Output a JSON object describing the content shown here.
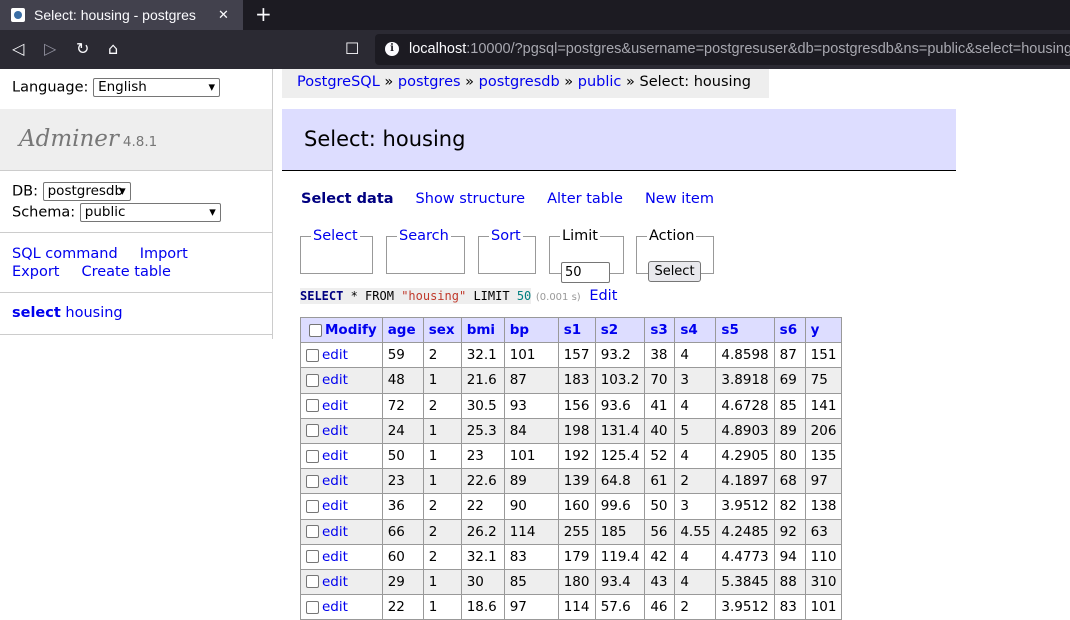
{
  "browser": {
    "tab_title": "Select: housing - postgres",
    "tab_close": "✕",
    "new_tab": "+",
    "url_host": "localhost",
    "url_rest": ":10000/?pgsql=postgres&username=postgresuser&db=postgresdb&ns=public&select=housing",
    "back": "◁",
    "forward": "▷",
    "reload": "↻",
    "home": "⌂",
    "bookmark": "☐"
  },
  "menu": {
    "language_label": "Language:",
    "language_value": "English",
    "logo": "Adminer",
    "version": "4.8.1",
    "db_label": "DB:",
    "db_value": "postgresdb",
    "schema_label": "Schema:",
    "schema_value": "public",
    "links": [
      "SQL command",
      "Import",
      "Export",
      "Create table"
    ],
    "select_label": "select",
    "table_name": "housing"
  },
  "breadcrumb": {
    "items": [
      "PostgreSQL",
      "postgres",
      "postgresdb",
      "public"
    ],
    "sep": " » ",
    "current": "Select: housing"
  },
  "page_title": "Select: housing",
  "nav": {
    "current": "Select data",
    "links": [
      "Show structure",
      "Alter table",
      "New item"
    ]
  },
  "form": {
    "select_legend": "Select",
    "search_legend": "Search",
    "sort_legend": "Sort",
    "limit_legend": "Limit",
    "limit_value": "50",
    "action_legend": "Action",
    "action_button": "Select"
  },
  "query": {
    "kw_select": "SELECT",
    "star": " * ",
    "kw_from": "FROM",
    "table": "\"housing\"",
    "kw_limit": "LIMIT",
    "limit": "50",
    "time": "(0.001 s)",
    "edit": "Edit"
  },
  "table": {
    "modify_label": "Modify",
    "columns": [
      "age",
      "sex",
      "bmi",
      "bp",
      "s1",
      "s2",
      "s3",
      "s4",
      "s5",
      "s6",
      "y"
    ],
    "edit_label": "edit",
    "rows": [
      [
        "59",
        "2",
        "32.1",
        "101",
        "157",
        "93.2",
        "38",
        "4",
        "4.8598",
        "87",
        "151"
      ],
      [
        "48",
        "1",
        "21.6",
        "87",
        "183",
        "103.2",
        "70",
        "3",
        "3.8918",
        "69",
        "75"
      ],
      [
        "72",
        "2",
        "30.5",
        "93",
        "156",
        "93.6",
        "41",
        "4",
        "4.6728",
        "85",
        "141"
      ],
      [
        "24",
        "1",
        "25.3",
        "84",
        "198",
        "131.4",
        "40",
        "5",
        "4.8903",
        "89",
        "206"
      ],
      [
        "50",
        "1",
        "23",
        "101",
        "192",
        "125.4",
        "52",
        "4",
        "4.2905",
        "80",
        "135"
      ],
      [
        "23",
        "1",
        "22.6",
        "89",
        "139",
        "64.8",
        "61",
        "2",
        "4.1897",
        "68",
        "97"
      ],
      [
        "36",
        "2",
        "22",
        "90",
        "160",
        "99.6",
        "50",
        "3",
        "3.9512",
        "82",
        "138"
      ],
      [
        "66",
        "2",
        "26.2",
        "114",
        "255",
        "185",
        "56",
        "4.55",
        "4.2485",
        "92",
        "63"
      ],
      [
        "60",
        "2",
        "32.1",
        "83",
        "179",
        "119.4",
        "42",
        "4",
        "4.4773",
        "94",
        "110"
      ],
      [
        "29",
        "1",
        "30",
        "85",
        "180",
        "93.4",
        "43",
        "4",
        "5.3845",
        "88",
        "310"
      ],
      [
        "22",
        "1",
        "18.6",
        "97",
        "114",
        "57.6",
        "46",
        "2",
        "3.9512",
        "83",
        "101"
      ]
    ]
  }
}
